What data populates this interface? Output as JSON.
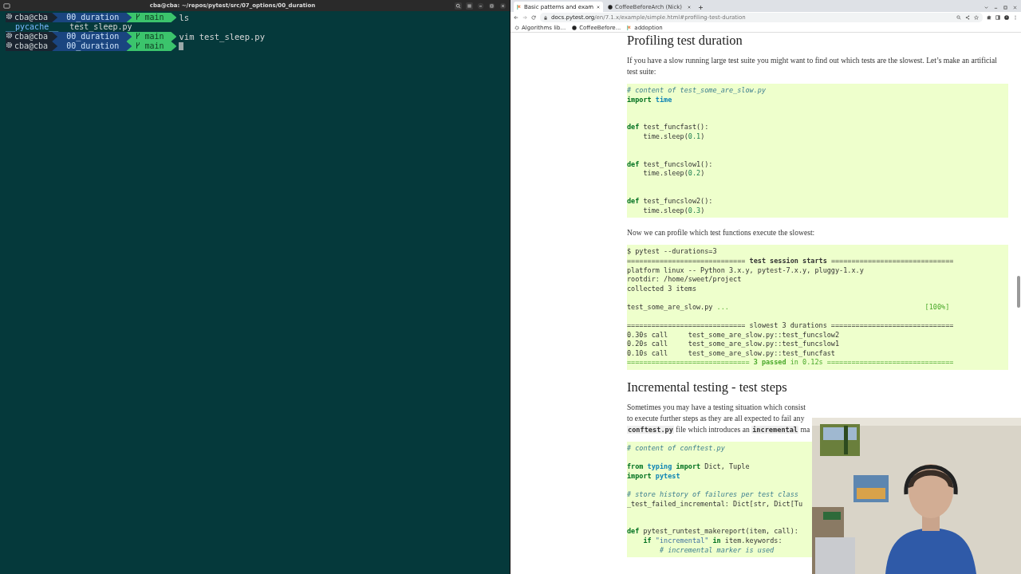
{
  "terminal": {
    "title": "cba@cba: ~/repos/pytest/src/07_options/00_duration",
    "lines": [
      {
        "kind": "prompt",
        "user": "cba@cba",
        "directory": "00_duration",
        "branch": "main",
        "command": "ls",
        "cursor": false
      },
      {
        "kind": "listing",
        "entries": [
          {
            "kind": "dir",
            "name": "__pycache__"
          },
          {
            "kind": "file",
            "name": "test_sleep.py"
          }
        ]
      },
      {
        "kind": "prompt",
        "user": "cba@cba",
        "directory": "00_duration",
        "branch": "main",
        "command": "vim test_sleep.py",
        "cursor": false
      },
      {
        "kind": "prompt",
        "user": "cba@cba",
        "directory": "00_duration",
        "branch": "main",
        "cursor": true
      }
    ]
  },
  "browser": {
    "tabs": [
      {
        "title": "Basic patterns and exam",
        "selected": true
      },
      {
        "title": "CoffeeBeforeArch (Nick)",
        "selected": false
      }
    ],
    "address": {
      "host": "docs.pytest.org",
      "path": "/en/7.1.x/example/simple.html#profiling-test-duration"
    },
    "bookmarks": [
      {
        "kind": "generic",
        "label": "Algorithms lib..."
      },
      {
        "kind": "github",
        "label": "CoffeeBefore..."
      },
      {
        "kind": "flag",
        "label": "addoption"
      }
    ],
    "page": {
      "sections": [
        {
          "kind": "heading",
          "text": "Profiling test duration"
        },
        {
          "kind": "paragraph",
          "text": "If you have a slow running large test suite you might want to find out which tests are the slowest. Let’s make an artificial test suite:"
        },
        {
          "kind": "code",
          "lines": [
            {
              "kind": "text",
              "tokens": [
                {
                  "kind": "cmt",
                  "text": "# content of test_some_are_slow.py"
                }
              ]
            },
            {
              "kind": "text",
              "tokens": [
                {
                  "kind": "kw",
                  "text": "import"
                },
                {
                  "kind": "mod",
                  "text": " time"
                }
              ]
            },
            {
              "kind": "blank"
            },
            {
              "kind": "blank"
            },
            {
              "kind": "text",
              "tokens": [
                {
                  "kind": "kw",
                  "text": "def"
                },
                {
                  "kind": "plain",
                  "text": " test_funcfast():"
                }
              ]
            },
            {
              "kind": "text",
              "tokens": [
                {
                  "kind": "plain",
                  "text": "    time.sleep("
                },
                {
                  "kind": "num",
                  "text": "0.1"
                },
                {
                  "kind": "plain",
                  "text": ")"
                }
              ]
            },
            {
              "kind": "blank"
            },
            {
              "kind": "blank"
            },
            {
              "kind": "text",
              "tokens": [
                {
                  "kind": "kw",
                  "text": "def"
                },
                {
                  "kind": "plain",
                  "text": " test_funcslow1():"
                }
              ]
            },
            {
              "kind": "text",
              "tokens": [
                {
                  "kind": "plain",
                  "text": "    time.sleep("
                },
                {
                  "kind": "num",
                  "text": "0.2"
                },
                {
                  "kind": "plain",
                  "text": ")"
                }
              ]
            },
            {
              "kind": "blank"
            },
            {
              "kind": "blank"
            },
            {
              "kind": "text",
              "tokens": [
                {
                  "kind": "kw",
                  "text": "def"
                },
                {
                  "kind": "plain",
                  "text": " test_funcslow2():"
                }
              ]
            },
            {
              "kind": "text",
              "tokens": [
                {
                  "kind": "plain",
                  "text": "    time.sleep("
                },
                {
                  "kind": "num",
                  "text": "0.3"
                },
                {
                  "kind": "plain",
                  "text": ")"
                }
              ]
            }
          ]
        },
        {
          "kind": "paragraph",
          "text": "Now we can profile which test functions execute the slowest:"
        },
        {
          "kind": "code",
          "lines": [
            {
              "kind": "text",
              "tokens": [
                {
                  "kind": "plain",
                  "text": "$ pytest --durations=3"
                }
              ]
            },
            {
              "kind": "text",
              "tokens": [
                {
                  "kind": "plain",
                  "text": "============================= "
                },
                {
                  "kind": "b",
                  "text": "test session starts"
                },
                {
                  "kind": "plain",
                  "text": " =============================="
                }
              ]
            },
            {
              "kind": "text",
              "tokens": [
                {
                  "kind": "plain",
                  "text": "platform linux -- Python 3.x.y, pytest-7.x.y, pluggy-1.x.y"
                }
              ]
            },
            {
              "kind": "text",
              "tokens": [
                {
                  "kind": "plain",
                  "text": "rootdir: /home/sweet/project"
                }
              ]
            },
            {
              "kind": "text",
              "tokens": [
                {
                  "kind": "plain",
                  "text": "collected 3 items"
                }
              ]
            },
            {
              "kind": "blank"
            },
            {
              "kind": "text",
              "tokens": [
                {
                  "kind": "plain",
                  "text": "test_some_are_slow.py "
                },
                {
                  "kind": "g",
                  "text": "..."
                },
                {
                  "kind": "right",
                  "text": "[100%]"
                }
              ]
            },
            {
              "kind": "blank"
            },
            {
              "kind": "text",
              "tokens": [
                {
                  "kind": "plain",
                  "text": "============================= slowest 3 durations =============================="
                }
              ]
            },
            {
              "kind": "text",
              "tokens": [
                {
                  "kind": "plain",
                  "text": "0.30s call     test_some_are_slow.py::test_funcslow2"
                }
              ]
            },
            {
              "kind": "text",
              "tokens": [
                {
                  "kind": "plain",
                  "text": "0.20s call     test_some_are_slow.py::test_funcslow1"
                }
              ]
            },
            {
              "kind": "text",
              "tokens": [
                {
                  "kind": "plain",
                  "text": "0.10s call     test_some_are_slow.py::test_funcfast"
                }
              ]
            },
            {
              "kind": "text",
              "tokens": [
                {
                  "kind": "g",
                  "text": "============================== "
                },
                {
                  "kind": "gb",
                  "text": "3 passed"
                },
                {
                  "kind": "g",
                  "text": " in 0.12s ==============================="
                }
              ]
            }
          ]
        },
        {
          "kind": "heading",
          "text": "Incremental testing - test steps"
        },
        {
          "kind": "lines",
          "lines": [
            [
              {
                "kind": "text",
                "text": "Sometimes you may have a testing situation which consist"
              }
            ],
            [
              {
                "kind": "text",
                "text": "to execute further steps as they are all expected to fail any"
              }
            ],
            [
              {
                "kind": "code",
                "text": "conftest.py"
              },
              {
                "kind": "text",
                "text": " file which introduces an "
              },
              {
                "kind": "code",
                "text": "incremental"
              },
              {
                "kind": "text",
                "text": " ma"
              }
            ]
          ]
        },
        {
          "kind": "code",
          "lines": [
            {
              "kind": "text",
              "tokens": [
                {
                  "kind": "cmt",
                  "text": "# content of conftest.py"
                }
              ]
            },
            {
              "kind": "blank"
            },
            {
              "kind": "text",
              "tokens": [
                {
                  "kind": "kw",
                  "text": "from"
                },
                {
                  "kind": "mod",
                  "text": " typing"
                },
                {
                  "kind": "kw",
                  "text": " import"
                },
                {
                  "kind": "plain",
                  "text": " Dict, Tuple"
                }
              ]
            },
            {
              "kind": "text",
              "tokens": [
                {
                  "kind": "kw",
                  "text": "import"
                },
                {
                  "kind": "mod",
                  "text": " pytest"
                }
              ]
            },
            {
              "kind": "blank"
            },
            {
              "kind": "text",
              "tokens": [
                {
                  "kind": "cmt",
                  "text": "# store history of failures per test class"
                }
              ]
            },
            {
              "kind": "text",
              "tokens": [
                {
                  "kind": "plain",
                  "text": "_test_failed_incremental: Dict[str, Dict[Tu"
                }
              ]
            },
            {
              "kind": "blank"
            },
            {
              "kind": "blank"
            },
            {
              "kind": "text",
              "tokens": [
                {
                  "kind": "kw",
                  "text": "def"
                },
                {
                  "kind": "plain",
                  "text": " pytest_runtest_makereport(item, call):"
                }
              ]
            },
            {
              "kind": "text",
              "tokens": [
                {
                  "kind": "kw",
                  "text": "    if"
                },
                {
                  "kind": "str",
                  "text": " \"incremental\""
                },
                {
                  "kind": "kw",
                  "text": " in"
                },
                {
                  "kind": "plain",
                  "text": " item.keywords:"
                }
              ]
            },
            {
              "kind": "text",
              "tokens": [
                {
                  "kind": "cmt",
                  "text": "        # incremental marker is used"
                }
              ]
            }
          ]
        }
      ]
    }
  }
}
